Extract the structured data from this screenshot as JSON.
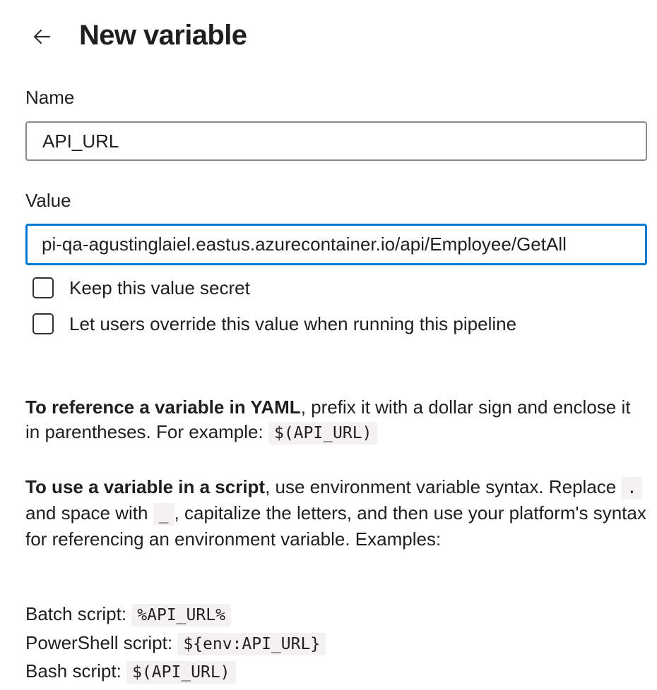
{
  "header": {
    "back_icon": "arrow-left-icon",
    "title": "New variable"
  },
  "name_field": {
    "label": "Name",
    "value": "API_URL"
  },
  "value_field": {
    "label": "Value",
    "value": "pi-qa-agustinglaiel.eastus.azurecontainer.io/api/Employee/GetAll"
  },
  "options": {
    "keep_secret": {
      "label": "Keep this value secret",
      "checked": false
    },
    "allow_override": {
      "label": "Let users override this value when running this pipeline",
      "checked": false
    }
  },
  "help": {
    "yaml": {
      "bold": "To reference a variable in YAML",
      "text1": ", prefix it with a dollar sign and enclose it in parentheses. For example:",
      "code": "$(API_URL)"
    },
    "script": {
      "bold": "To use a variable in a script",
      "text1": ", use environment variable syntax. Replace",
      "code_dot": ".",
      "text2": "and space with",
      "code_underscore": "_",
      "text3": ", capitalize the letters, and then use your platform's syntax for referencing an environment variable. Examples:"
    },
    "examples": [
      {
        "label": "Batch script:",
        "code": "%API_URL%"
      },
      {
        "label": "PowerShell script:",
        "code": "${env:API_URL}"
      },
      {
        "label": "Bash script:",
        "code": "$(API_URL)"
      }
    ]
  },
  "colors": {
    "focus_border": "#0078d4",
    "input_border": "#8a8886",
    "code_background": "#f3f2f1",
    "text": "#201f1e"
  }
}
